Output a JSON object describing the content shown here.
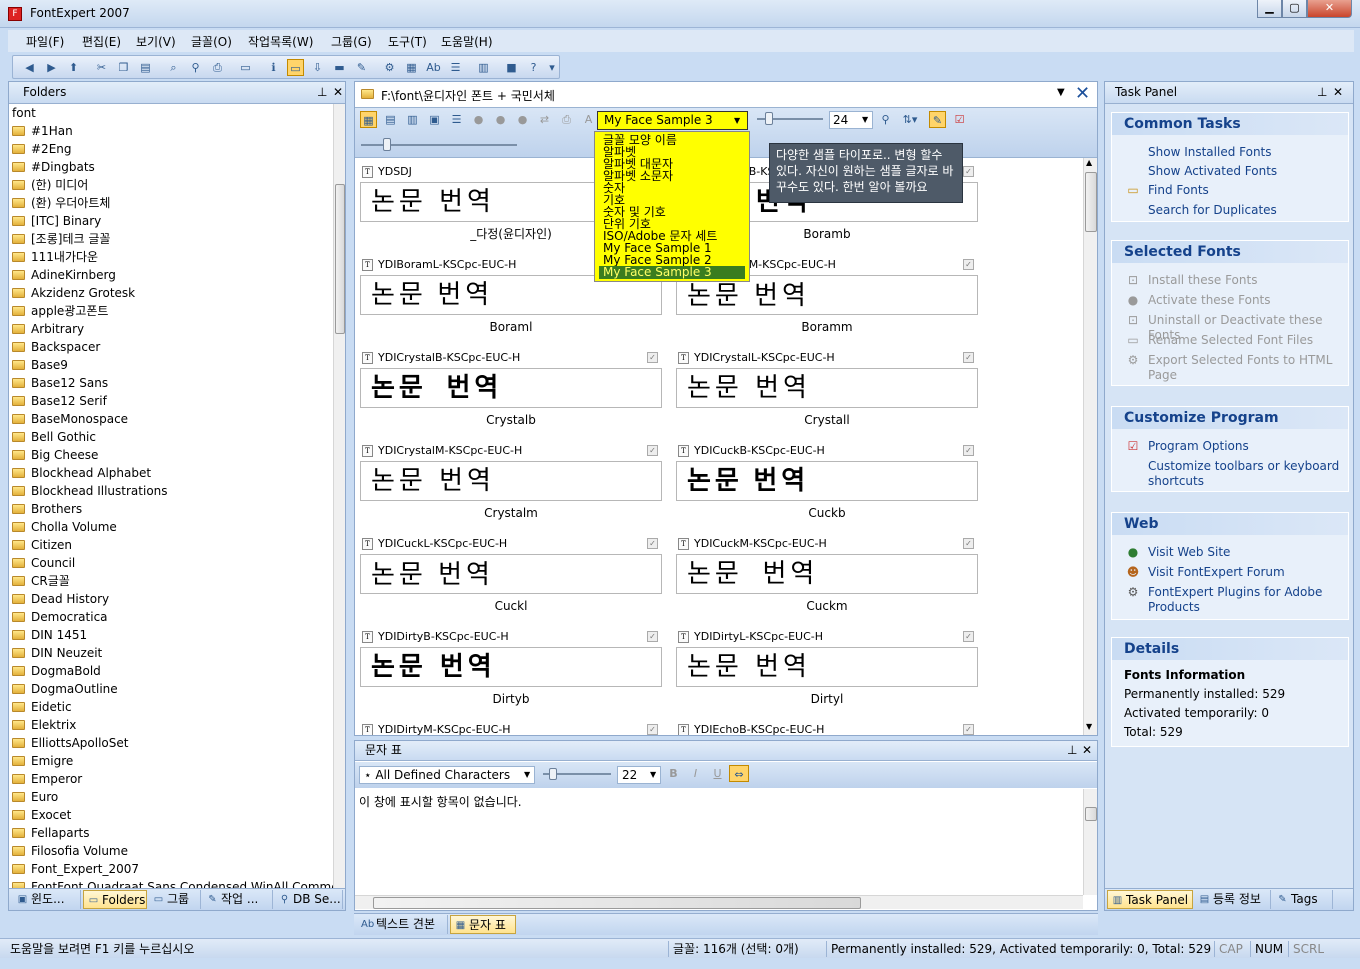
{
  "window": {
    "title": "FontExpert 2007"
  },
  "menu": [
    "파일(F)",
    "편집(E)",
    "보기(V)",
    "글꼴(O)",
    "작업목록(W)",
    "그룹(G)",
    "도구(T)",
    "도움말(H)"
  ],
  "folders": {
    "title": "Folders",
    "root": "font",
    "items": [
      "#1Han",
      "#2Eng",
      "#Dingbats",
      "(한) 미디어",
      "(환) 우더아트체",
      "[ITC] Binary",
      "[조롱]테크 글꼴",
      "111내가다운",
      "AdineKirnberg",
      "Akzidenz Grotesk",
      "apple광고폰트",
      "Arbitrary",
      "Backspacer",
      "Base9",
      "Base12 Sans",
      "Base12 Serif",
      "BaseMonospace",
      "Bell Gothic",
      "Big Cheese",
      "Blockhead Alphabet",
      "Blockhead Illustrations",
      "Brothers",
      "Cholla Volume",
      "Citizen",
      "Council",
      "CR글꼴",
      "Dead History",
      "Democratica",
      "DIN 1451",
      "DIN Neuzeit",
      "DogmaBold",
      "DogmaOutline",
      "Eidetic",
      "Elektrix",
      "ElliottsApolloSet",
      "Emigre",
      "Emperor",
      "Euro",
      "Exocet",
      "Fellaparts",
      "Filosofia Volume",
      "Font_Expert_2007",
      "FontFont.Quadraat.Sans.Condensed.WinAll.Commercial."
    ]
  },
  "path": "F:\\font\\윤디자인 폰트 + 국민서체",
  "sample": {
    "selected": "My Face Sample 3",
    "size": "24",
    "text": "논문 번역",
    "options": [
      "글꼴 모양 이름",
      "알파벳",
      "알파벳 대문자",
      "알파벳 소문자",
      "숫자",
      "기호",
      "숫자 및 기호",
      "단위 기호",
      "ISO/Adobe 문자 세트",
      "My Face Sample 1",
      "My Face Sample 2",
      "My Face Sample 3"
    ],
    "tooltip": "다양한 샘플 타이포로.. 변형 할수 있다.  자신이 원하는 샘플 글자로 바꾸수도 있다. 한번 알아 볼까요"
  },
  "fonts": [
    {
      "file": "YDSDJ",
      "label": "_다정(윤디자인)"
    },
    {
      "file": "YDIBoramB-KSCpc-EUC-H",
      "label": "Boramb"
    },
    {
      "file": "YDIBoramL-KSCpc-EUC-H",
      "label": "Boraml"
    },
    {
      "file": "YDIBoramM-KSCpc-EUC-H",
      "label": "Boramm"
    },
    {
      "file": "YDICrystalB-KSCpc-EUC-H",
      "label": "Crystalb"
    },
    {
      "file": "YDICrystalL-KSCpc-EUC-H",
      "label": "Crystall"
    },
    {
      "file": "YDICrystalM-KSCpc-EUC-H",
      "label": "Crystalm"
    },
    {
      "file": "YDICuckB-KSCpc-EUC-H",
      "label": "Cuckb"
    },
    {
      "file": "YDICuckL-KSCpc-EUC-H",
      "label": "Cuckl"
    },
    {
      "file": "YDICuckM-KSCpc-EUC-H",
      "label": "Cuckm"
    },
    {
      "file": "YDIDirtyB-KSCpc-EUC-H",
      "label": "Dirtyb"
    },
    {
      "file": "YDIDirtyL-KSCpc-EUC-H",
      "label": "Dirtyl"
    },
    {
      "file": "YDIDirtyM-KSCpc-EUC-H",
      "label": ""
    },
    {
      "file": "YDIEchoB-KSCpc-EUC-H",
      "label": ""
    }
  ],
  "charmap": {
    "title": "문자 표",
    "filter": "All Defined Characters",
    "size": "22",
    "empty": "이 창에 표시할 항목이 없습니다."
  },
  "task": {
    "title": "Task Panel",
    "common": {
      "title": "Common Tasks",
      "links": [
        "Show Installed Fonts",
        "Show Activated Fonts",
        "Find Fonts",
        "Search for Duplicates"
      ]
    },
    "selected": {
      "title": "Selected Fonts",
      "links": [
        "Install these Fonts",
        "Activate these Fonts",
        "Uninstall or Deactivate these Fonts",
        "Rename Selected Font Files",
        "Export Selected Fonts to HTML Page"
      ]
    },
    "customize": {
      "title": "Customize Program",
      "links": [
        "Program Options",
        "Customize toolbars or keyboard shortcuts"
      ]
    },
    "web": {
      "title": "Web",
      "links": [
        "Visit Web Site",
        "Visit FontExpert Forum",
        "FontExpert Plugins for Adobe Products"
      ]
    },
    "details": {
      "title": "Details",
      "heading": "Fonts Information",
      "lines": [
        "Permanently installed: 529",
        "Activated temporarily: 0",
        "Total: 529"
      ]
    }
  },
  "tabs": {
    "left": [
      "윈도...",
      "Folders",
      "그룹",
      "작업 ...",
      "DB Se..."
    ],
    "center": [
      "텍스트 견본",
      "문자 표"
    ],
    "right": [
      "Task Panel",
      "등록 정보",
      "Tags"
    ]
  },
  "status": {
    "help": "도움말을 보려면 F1 키를 누르십시오",
    "count": "글꼴: 116개 (선택: 0개)",
    "summary": "Permanently installed: 529, Activated temporarily: 0, Total: 529",
    "cap": "CAP",
    "num": "NUM",
    "scrl": "SCRL"
  }
}
